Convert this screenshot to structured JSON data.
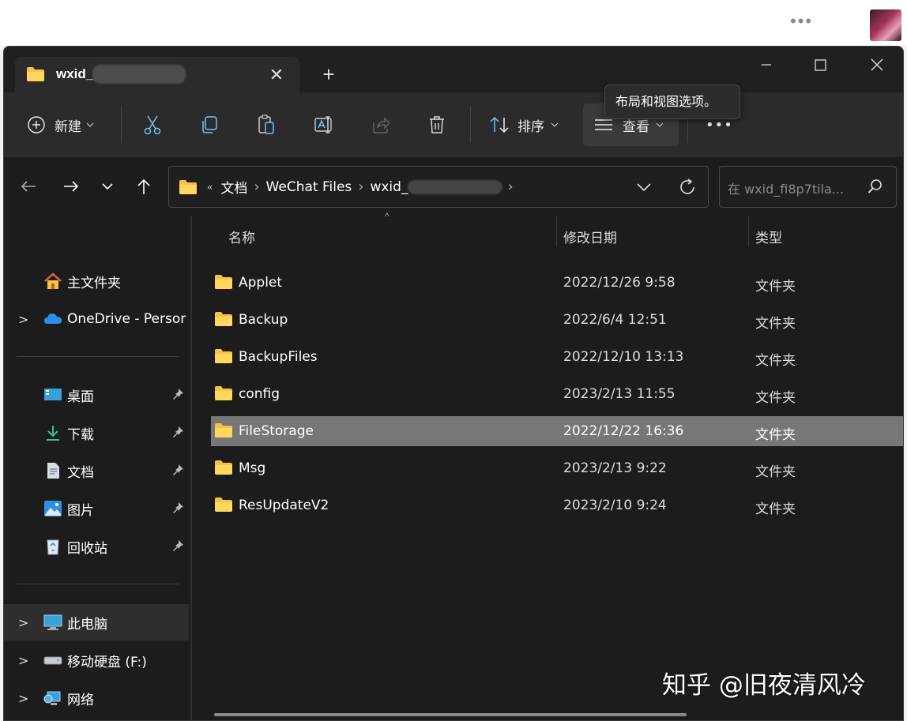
{
  "tab": {
    "title": "wxid_",
    "close": "✕"
  },
  "new_tab": "+",
  "window_controls": {
    "minimize": "—",
    "maximize": "☐",
    "close": "✕"
  },
  "toolbar": {
    "new_label": "新建",
    "sort_label": "排序",
    "view_label": "查看",
    "more": "•••",
    "tooltip": "布局和视图选项。"
  },
  "address": {
    "overflow": "«",
    "crumbs": [
      "文档",
      "WeChat Files",
      "wxid_"
    ],
    "separator": "›"
  },
  "search": {
    "placeholder": "在 wxid_fi8p7tila..."
  },
  "sidebar": {
    "home": "主文件夹",
    "onedrive": "OneDrive - Persor",
    "quick": [
      "桌面",
      "下载",
      "文档",
      "图片",
      "回收站"
    ],
    "this_pc": "此电脑",
    "drive": "移动硬盘 (F:)",
    "network": "网络"
  },
  "columns": {
    "name": "名称",
    "date": "修改日期",
    "type": "类型"
  },
  "files": [
    {
      "name": "Applet",
      "date": "2022/12/26 9:58",
      "type": "文件夹"
    },
    {
      "name": "Backup",
      "date": "2022/6/4 12:51",
      "type": "文件夹"
    },
    {
      "name": "BackupFiles",
      "date": "2022/12/10 13:13",
      "type": "文件夹"
    },
    {
      "name": "config",
      "date": "2023/2/13 11:55",
      "type": "文件夹"
    },
    {
      "name": "FileStorage",
      "date": "2022/12/22 16:36",
      "type": "文件夹"
    },
    {
      "name": "Msg",
      "date": "2023/2/13 9:22",
      "type": "文件夹"
    },
    {
      "name": "ResUpdateV2",
      "date": "2023/2/10 9:24",
      "type": "文件夹"
    }
  ],
  "watermark": "知乎 @旧夜清风冷",
  "topbar": {
    "dots": "•••"
  },
  "colors": {
    "selected_row": "#777777",
    "folder": "#f5c342",
    "bg": "#1c1c1c"
  }
}
